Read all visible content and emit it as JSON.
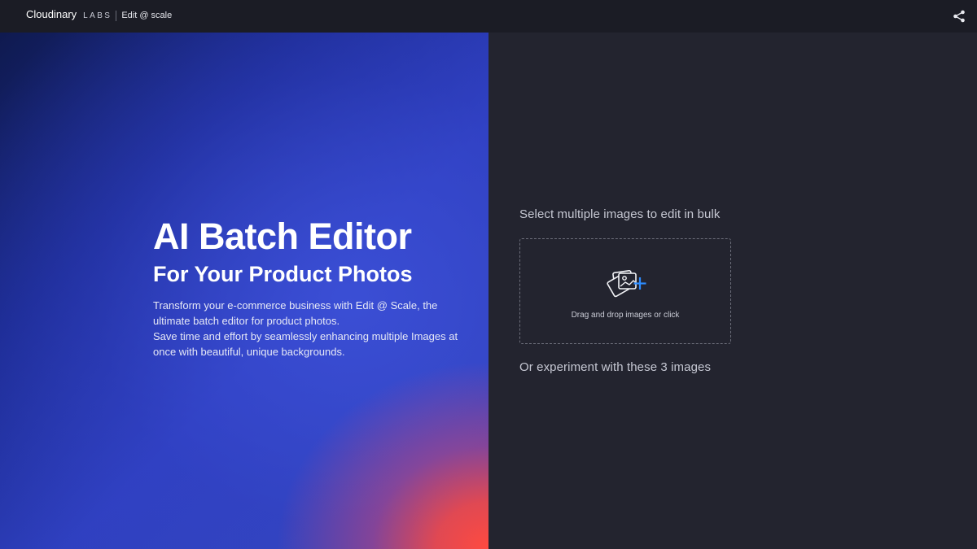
{
  "header": {
    "brand": "Cloudinary",
    "labs": "LABS",
    "product": "Edit @ scale",
    "share_icon": "share-icon"
  },
  "hero": {
    "title": "AI Batch Editor",
    "subtitle": "For Your Product Photos",
    "desc_line1": "Transform your e-commerce business with Edit @ Scale, the ultimate batch editor for product photos.",
    "desc_line2": "Save time and effort by seamlessly enhancing multiple Images at once with beautiful, unique backgrounds."
  },
  "upload": {
    "select_label": "Select multiple images to edit in bulk",
    "dropzone_text": "Drag and drop images or click",
    "dropzone_icon": "add-images-icon",
    "experiment_label": "Or experiment with these 3 images"
  },
  "colors": {
    "topbar": "#1b1c25",
    "panel_dark": "#23242f",
    "accent_blue": "#3448f0",
    "plus_blue": "#2d8cff",
    "gradient_red": "#ff4a40"
  }
}
